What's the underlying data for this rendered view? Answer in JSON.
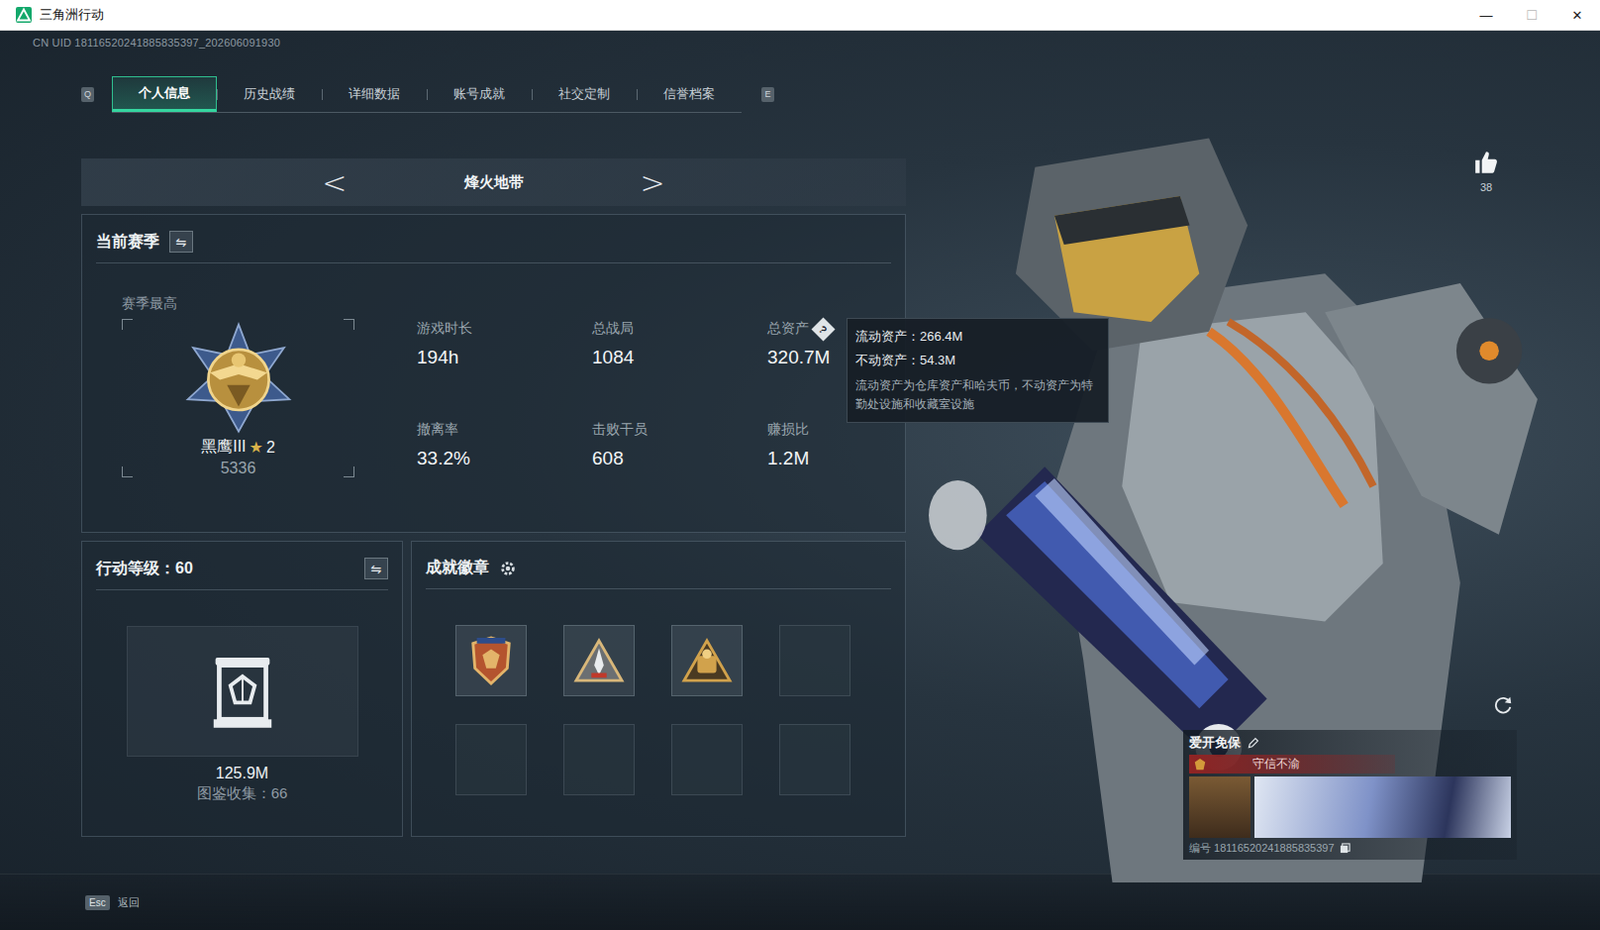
{
  "window": {
    "title": "三角洲行动",
    "controls": [
      {
        "label": "—",
        "disabled": false
      },
      {
        "label": "☐",
        "disabled": true
      },
      {
        "label": "✕",
        "disabled": false
      }
    ]
  },
  "uid": "CN UID 18116520241885835397_202606091930",
  "tab_keys": {
    "prev": "Q",
    "next": "E"
  },
  "tabs": [
    {
      "label": "个人信息",
      "selected": true
    },
    {
      "label": "历史战绩",
      "selected": false
    },
    {
      "label": "详细数据",
      "selected": false
    },
    {
      "label": "账号成就",
      "selected": false
    },
    {
      "label": "社交定制",
      "selected": false
    },
    {
      "label": "信誉档案",
      "selected": false
    }
  ],
  "mode": {
    "prev": "<",
    "label": "烽火地带",
    "next": ">"
  },
  "season": {
    "title": "当前赛季",
    "swap_icon": "⇋",
    "best_label": "赛季最高",
    "rank": "黑鹰III",
    "star": "★",
    "stars": "2",
    "score": "5336",
    "stats": [
      {
        "label": "游戏时长",
        "value": "194h"
      },
      {
        "label": "总战局",
        "value": "1084"
      },
      {
        "label": "总资产",
        "value": "320.7M",
        "help": "?"
      },
      {
        "label": "撤离率",
        "value": "33.2%"
      },
      {
        "label": "击败干员",
        "value": "608"
      },
      {
        "label": "赚损比",
        "value": "1.2M"
      }
    ]
  },
  "tooltip": {
    "lines": [
      "流动资产：266.4M",
      "不动资产：54.3M"
    ],
    "note": "流动资产为仓库资产和哈夫币，不动资产为特勤处设施和收藏室设施"
  },
  "level": {
    "title": "行动等级：60",
    "swap_icon": "⇋",
    "value": "125.9M",
    "collection": "图鉴收集：66"
  },
  "badges": {
    "title": "成就徽章",
    "slots": [
      {
        "filled": true,
        "kind": "shield"
      },
      {
        "filled": true,
        "kind": "rocket"
      },
      {
        "filled": true,
        "kind": "crest"
      },
      {
        "filled": false,
        "kind": "none"
      },
      {
        "filled": false,
        "kind": "none"
      },
      {
        "filled": false,
        "kind": "none"
      },
      {
        "filled": false,
        "kind": "none"
      },
      {
        "filled": false,
        "kind": "none"
      }
    ]
  },
  "likes": {
    "count": "38"
  },
  "profile": {
    "name": "爱开免保",
    "tag": "守信不渝",
    "id_label": "编号 18116520241885835397"
  },
  "footer": {
    "key": "Esc",
    "label": "返回"
  }
}
